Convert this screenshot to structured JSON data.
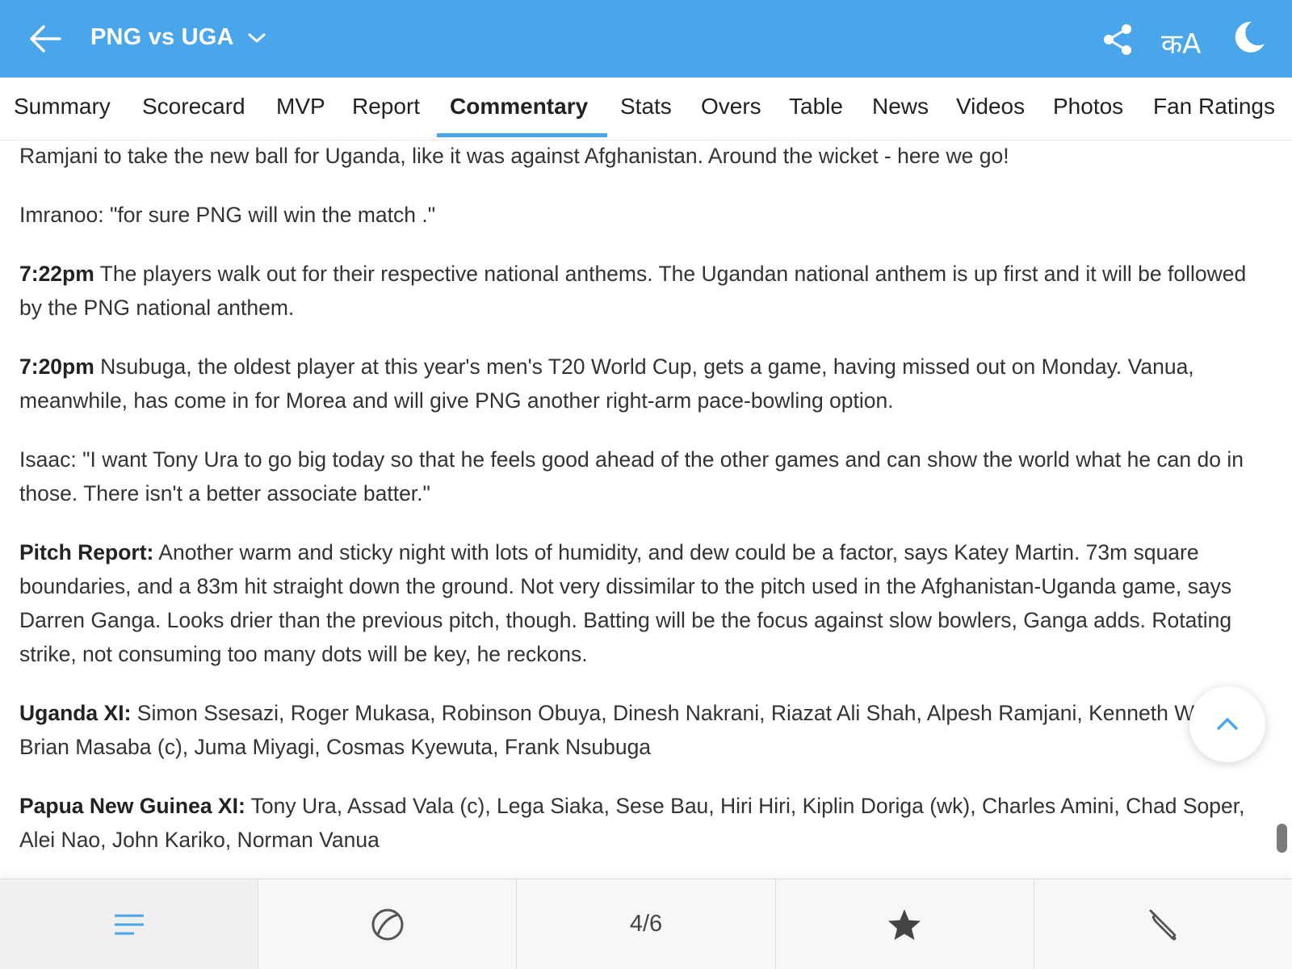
{
  "header": {
    "title": "PNG vs UGA",
    "lang_icon_text": "कA"
  },
  "tabs": [
    {
      "label": "Summary"
    },
    {
      "label": "Scorecard"
    },
    {
      "label": "MVP"
    },
    {
      "label": "Report"
    },
    {
      "label": "Commentary",
      "active": true
    },
    {
      "label": "Stats"
    },
    {
      "label": "Overs"
    },
    {
      "label": "Table"
    },
    {
      "label": "News"
    },
    {
      "label": "Videos"
    },
    {
      "label": "Photos"
    },
    {
      "label": "Fan Ratings"
    }
  ],
  "commentary": [
    {
      "lead": "",
      "text": "Ramjani to take the new ball for Uganda, like it was against Afghanistan. Around the wicket - here we go!"
    },
    {
      "lead": "",
      "text": "Imranoo: \"for sure PNG will win the match .\""
    },
    {
      "lead": "7:22pm",
      "text": " The players walk out for their respective national anthems. The Ugandan national anthem is up first and it will be followed by the PNG national anthem."
    },
    {
      "lead": "7:20pm",
      "text": " Nsubuga, the oldest player at this year's men's T20 World Cup, gets a game, having missed out on Monday. Vanua, meanwhile, has come in for Morea and will give PNG another right-arm pace-bowling option."
    },
    {
      "lead": "",
      "text": "Isaac: \"I want Tony Ura to go big today so that he feels good ahead of the other games and can show the world what he can do in those. There isn't a better associate batter.\""
    },
    {
      "lead": "Pitch Report:",
      "text": " Another warm and sticky night with lots of humidity, and dew could be a factor, says Katey Martin. 73m square boundaries, and a 83m hit straight down the ground. Not very dissimilar to the pitch used in the Afghanistan-Uganda game, says Darren Ganga. Looks drier than the previous pitch, though. Batting will be the focus against slow bowlers, Ganga adds. Rotating strike, not consuming too many dots will be key, he reckons."
    },
    {
      "lead": "Uganda XI:",
      "text": " Simon Ssesazi, Roger Mukasa, Robinson Obuya, Dinesh Nakrani, Riazat Ali Shah, Alpesh Ramjani, Kenneth Waiswa, Brian Masaba (c), Juma Miyagi, Cosmas Kyewuta, Frank Nsubuga"
    },
    {
      "lead": "Papua New Guinea XI:",
      "text": " Tony Ura, Assad Vala (c), Lega Siaka, Sese Bau, Hiri Hiri, Kiplin Doriga (wk), Charles Amini, Chad Soper, Alei Nao, John Kariko, Norman Vanua"
    }
  ],
  "bottom_nav": {
    "items": [
      "menu-icon",
      "ball-icon",
      "page-indicator",
      "star-icon",
      "bat-icon"
    ],
    "page_indicator": "4/6"
  },
  "colors": {
    "accent": "#4aa6ea",
    "header_bg": "#4aa6ea"
  }
}
